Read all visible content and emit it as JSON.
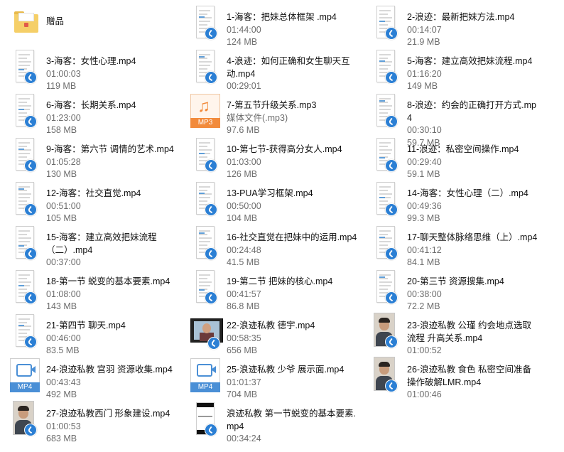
{
  "items": [
    {
      "id": "gift-folder",
      "icon": "folder",
      "name": "赠品",
      "lines": []
    },
    {
      "id": "f1",
      "icon": "video",
      "name": "1-海客：把妹总体框架 .mp4",
      "lines": [
        "01:44:00",
        "124 MB"
      ]
    },
    {
      "id": "f2",
      "icon": "video",
      "name": "2-浪迹：最新把妹方法.mp4",
      "lines": [
        "00:14:07",
        "21.9 MB"
      ]
    },
    {
      "id": "f3",
      "icon": "video",
      "name": "3-海客：女性心理.mp4",
      "lines": [
        "01:00:03",
        "119 MB"
      ]
    },
    {
      "id": "f4",
      "icon": "video",
      "name": "4-浪迹：如何正确和女生聊天互动.mp4",
      "lines": [
        "00:29:01"
      ]
    },
    {
      "id": "f5",
      "icon": "video",
      "name": "5-海客：建立高效把妹流程.mp4",
      "lines": [
        "01:16:20",
        "149 MB"
      ]
    },
    {
      "id": "f6",
      "icon": "video",
      "name": "6-海客：长期关系.mp4",
      "lines": [
        "01:23:00",
        "158 MB"
      ]
    },
    {
      "id": "f7",
      "icon": "mp3",
      "name": "7-第五节升级关系.mp3",
      "lines": [
        "媒体文件(.mp3)",
        "97.6 MB"
      ]
    },
    {
      "id": "f8",
      "icon": "video",
      "name": "8-浪迹：约会的正确打开方式.mp4",
      "lines": [
        "00:30:10",
        "59.7 MB"
      ]
    },
    {
      "id": "f9",
      "icon": "video",
      "name": "9-海客：第六节 调情的艺术.mp4",
      "lines": [
        "01:05:28",
        "130 MB"
      ]
    },
    {
      "id": "f10",
      "icon": "video",
      "name": "10-第七节-获得高分女人.mp4",
      "lines": [
        "01:03:00",
        "126 MB"
      ]
    },
    {
      "id": "f11",
      "icon": "video",
      "name": "11-浪迹：私密空间操作.mp4",
      "lines": [
        "00:29:40",
        "59.1 MB"
      ]
    },
    {
      "id": "f12",
      "icon": "video",
      "name": "12-海客：社交直觉.mp4",
      "lines": [
        "00:51:00",
        "105 MB"
      ]
    },
    {
      "id": "f13",
      "icon": "video",
      "name": "13-PUA学习框架.mp4",
      "lines": [
        "00:50:00",
        "104 MB"
      ]
    },
    {
      "id": "f14",
      "icon": "video",
      "name": "14-海客：女性心理（二）.mp4",
      "lines": [
        "00:49:36",
        "99.3 MB"
      ]
    },
    {
      "id": "f15",
      "icon": "video",
      "name": "15-海客：建立高效把妹流程（二）.mp4",
      "lines": [
        "00:37:00"
      ]
    },
    {
      "id": "f16",
      "icon": "video",
      "name": "16-社交直觉在把妹中的运用.mp4",
      "lines": [
        "00:24:48",
        "41.5 MB"
      ]
    },
    {
      "id": "f17",
      "icon": "video",
      "name": "17-聊天整体脉络思维（上）.mp4",
      "lines": [
        "00:41:12",
        "84.1 MB"
      ]
    },
    {
      "id": "f18",
      "icon": "video",
      "name": "18-第一节 蜕变的基本要素.mp4",
      "lines": [
        "01:08:00",
        "143 MB"
      ]
    },
    {
      "id": "f19",
      "icon": "video",
      "name": "19-第二节 把妹的核心.mp4",
      "lines": [
        "00:41:57",
        "86.8 MB"
      ]
    },
    {
      "id": "f20",
      "icon": "video",
      "name": "20-第三节 资源搜集.mp4",
      "lines": [
        "00:38:00",
        "72.2 MB"
      ]
    },
    {
      "id": "f21",
      "icon": "video",
      "name": "21-第四节 聊天.mp4",
      "lines": [
        "00:46:00",
        "83.5 MB"
      ]
    },
    {
      "id": "f22",
      "icon": "film",
      "name": "22-浪迹私教 德宇.mp4",
      "lines": [
        "00:58:35",
        "656 MB"
      ]
    },
    {
      "id": "f23",
      "icon": "photo",
      "name": "23-浪迹私教 公瑾 约会地点选取 流程 升高关系.mp4",
      "lines": [
        "01:00:52"
      ]
    },
    {
      "id": "f24",
      "icon": "mp4",
      "name": "24-浪迹私教 宫羽 资源收集.mp4",
      "lines": [
        "00:43:43",
        "492 MB"
      ]
    },
    {
      "id": "f25",
      "icon": "mp4",
      "name": "25-浪迹私教 少爷 展示面.mp4",
      "lines": [
        "01:01:37",
        "704 MB"
      ]
    },
    {
      "id": "f26",
      "icon": "photo",
      "name": "26-浪迹私教 食色 私密空间准备 操作破解LMR.mp4",
      "lines": [
        "01:00:46"
      ]
    },
    {
      "id": "f27",
      "icon": "photo",
      "name": "27-浪迹私教西门 形象建设.mp4",
      "lines": [
        "01:00:53",
        "683 MB"
      ]
    },
    {
      "id": "f28",
      "icon": "blackdoc",
      "name": "浪迹私教 第一节蜕变的基本要素.mp4",
      "lines": [
        "00:34:24"
      ]
    }
  ],
  "labels": {
    "mp3": "MP3",
    "mp4": "MP4"
  }
}
